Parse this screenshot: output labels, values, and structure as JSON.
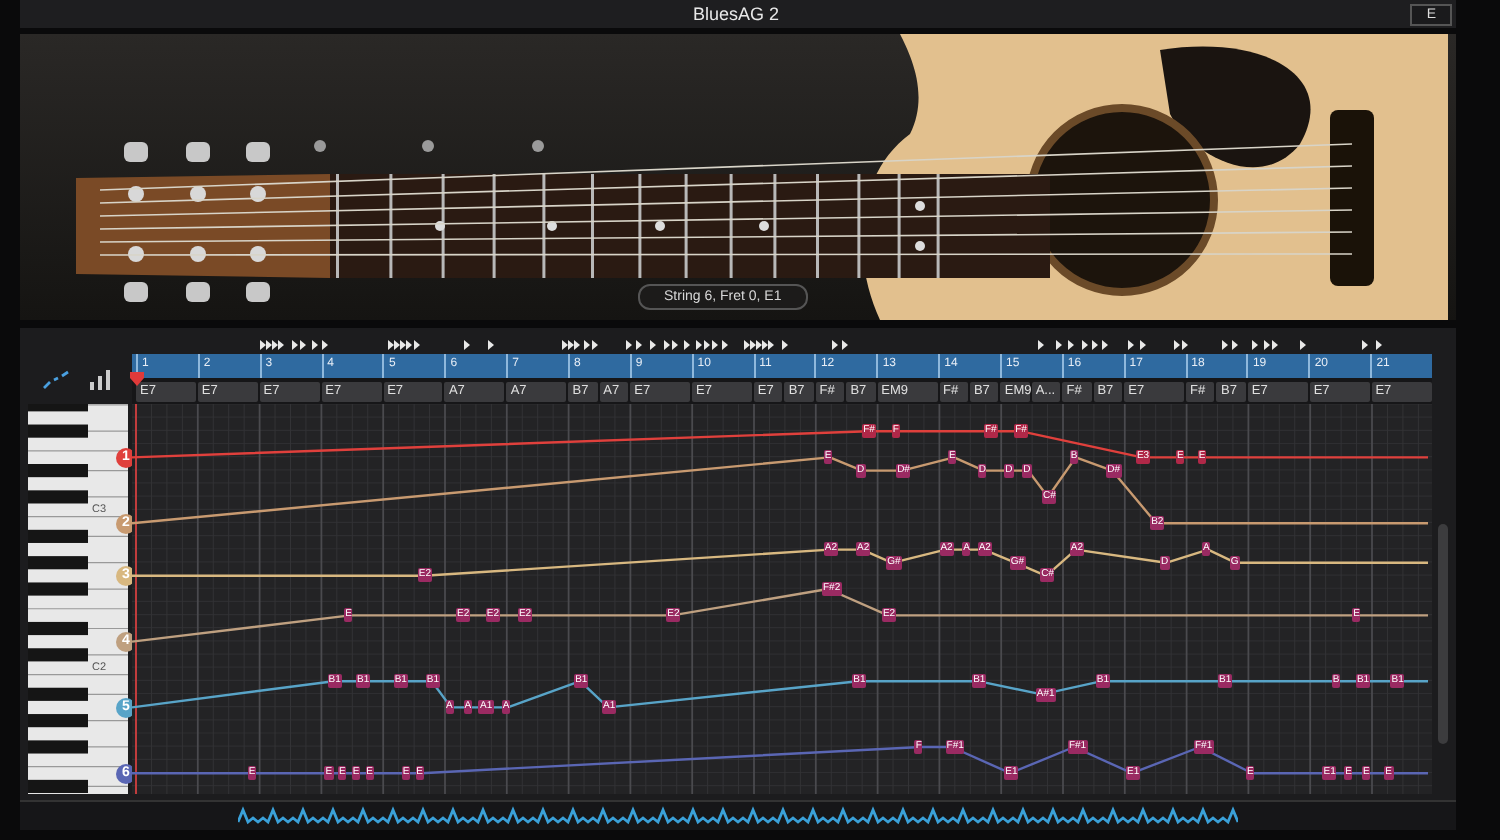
{
  "window": {
    "title": "BluesAG 2",
    "corner_button": "E"
  },
  "guitar_panel": {
    "status": "String 6, Fret 0, E1"
  },
  "bars": [
    {
      "number": "1",
      "chords": [
        "E7"
      ]
    },
    {
      "number": "2",
      "chords": [
        "E7"
      ]
    },
    {
      "number": "3",
      "chords": [
        "E7"
      ]
    },
    {
      "number": "4",
      "chords": [
        "E7"
      ]
    },
    {
      "number": "5",
      "chords": [
        "E7"
      ]
    },
    {
      "number": "6",
      "chords": [
        "A7"
      ]
    },
    {
      "number": "7",
      "chords": [
        "A7"
      ]
    },
    {
      "number": "8",
      "chords": [
        "B7",
        "A7"
      ]
    },
    {
      "number": "9",
      "chords": [
        "E7"
      ]
    },
    {
      "number": "10",
      "chords": [
        "E7"
      ]
    },
    {
      "number": "11",
      "chords": [
        "E7",
        "B7"
      ]
    },
    {
      "number": "12",
      "chords": [
        "F#",
        "B7"
      ]
    },
    {
      "number": "13",
      "chords": [
        "EM9"
      ]
    },
    {
      "number": "14",
      "chords": [
        "F#",
        "B7"
      ]
    },
    {
      "number": "15",
      "chords": [
        "EM9",
        "A..."
      ]
    },
    {
      "number": "16",
      "chords": [
        "F#",
        "B7"
      ]
    },
    {
      "number": "17",
      "chords": [
        "E7"
      ]
    },
    {
      "number": "18",
      "chords": [
        "F#",
        "B7"
      ]
    },
    {
      "number": "19",
      "chords": [
        "E7"
      ]
    },
    {
      "number": "20",
      "chords": [
        "E7"
      ]
    },
    {
      "number": "21",
      "chords": [
        "E7"
      ]
    }
  ],
  "keyboard_labels": [
    "C3",
    "C2"
  ],
  "strings": [
    {
      "number": "1",
      "color": "#e0403c",
      "notes": [
        "F#",
        "F",
        "F#",
        "F#",
        "E3",
        "E",
        "E"
      ]
    },
    {
      "number": "2",
      "color": "#c89a70",
      "notes": [
        "E",
        "D",
        "D#",
        "E",
        "D",
        "D",
        "D",
        "C#",
        "B",
        "D#",
        "B2"
      ]
    },
    {
      "number": "3",
      "color": "#d8b880",
      "notes": [
        "E2",
        "A2",
        "A2",
        "G#",
        "A2",
        "A",
        "A2",
        "G#",
        "C#",
        "A2",
        "D",
        "A",
        "G"
      ]
    },
    {
      "number": "4",
      "color": "#bfa080",
      "notes": [
        "E",
        "E2",
        "E2",
        "E2",
        "E2",
        "F#2",
        "E2",
        "E"
      ]
    },
    {
      "number": "5",
      "color": "#58a4c8",
      "notes": [
        "B1",
        "B1",
        "B1",
        "B1",
        "A",
        "A",
        "A1",
        "A",
        "B1",
        "A1",
        "B1",
        "B1",
        "A#1",
        "B1",
        "B1",
        "B",
        "B1",
        "B1"
      ]
    },
    {
      "number": "6",
      "color": "#5a66b4",
      "notes": [
        "E",
        "E",
        "E",
        "E",
        "E",
        "E",
        "E",
        "F",
        "F#1",
        "E1",
        "F#1",
        "E1",
        "F#1",
        "E",
        "E1",
        "E",
        "E",
        "E"
      ]
    }
  ]
}
